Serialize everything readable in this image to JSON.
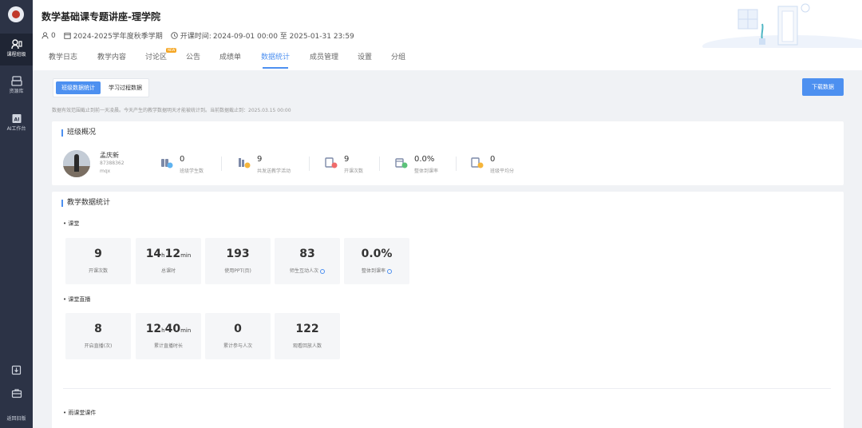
{
  "sidebar": {
    "items": [
      {
        "label": "课程班级",
        "icon": "class-icon",
        "active": true
      },
      {
        "label": "资源库",
        "icon": "library-icon",
        "active": false
      },
      {
        "label": "AI工作台",
        "icon": "ai-icon",
        "active": false
      }
    ],
    "bottom": {
      "label": "返回旧版"
    }
  },
  "header": {
    "title": "数学基础课专题讲座-理学院",
    "people_count": "0",
    "semester": "2024-2025学年度秋季学期",
    "time_label": "开课时间:",
    "time_value": "2024-09-01 00:00 至 2025-01-31 23:59",
    "tabs": [
      {
        "label": "教学日志"
      },
      {
        "label": "教学内容"
      },
      {
        "label": "讨论区",
        "badge": "NEW"
      },
      {
        "label": "公告"
      },
      {
        "label": "成绩单"
      },
      {
        "label": "数据统计",
        "active": true
      },
      {
        "label": "成员管理"
      },
      {
        "label": "设置"
      },
      {
        "label": "分组"
      }
    ]
  },
  "toolbar": {
    "toggle": [
      "班级数据统计",
      "学习过程数据"
    ],
    "download_label": "下载数据",
    "note": "数据有效范围截止到前一天凌晨。今天产生的教学数据明天才能被统计到。当前数据截止到：2025.03.15 00:00"
  },
  "overview": {
    "title": "班级概况",
    "teacher": {
      "name": "孟庆新",
      "id": "87388362",
      "sub": "mqx"
    },
    "stats": [
      {
        "value": "0",
        "label": "班级学生数",
        "icon": "students-icon"
      },
      {
        "value": "9",
        "label": "共发送教学活动",
        "icon": "activities-icon"
      },
      {
        "value": "9",
        "label": "开课次数",
        "icon": "lessons-icon"
      },
      {
        "value": "0.0%",
        "label": "整体到课率",
        "icon": "attendance-icon"
      },
      {
        "value": "0",
        "label": "班级平均分",
        "icon": "average-score-icon"
      }
    ]
  },
  "teaching": {
    "title": "教学数据统计",
    "sections": [
      {
        "label": "课堂",
        "stats": [
          {
            "value": "9",
            "label": "开课次数"
          },
          {
            "value_h": "14",
            "unit_h": "h",
            "value_m": "12",
            "unit_m": "min",
            "label": "总课时"
          },
          {
            "value": "193",
            "label": "使用PPT(页)"
          },
          {
            "value": "83",
            "label": "师生互动人次",
            "info": true
          },
          {
            "value": "0.0%",
            "label": "整体到课率",
            "info": true
          }
        ]
      },
      {
        "label": "课堂直播",
        "stats": [
          {
            "value": "8",
            "label": "开启直播(次)"
          },
          {
            "value_h": "12",
            "unit_h": "h",
            "value_m": "40",
            "unit_m": "min",
            "label": "累计直播时长"
          },
          {
            "value": "0",
            "label": "累计参与人次"
          },
          {
            "value": "122",
            "label": "观看回放人数"
          }
        ]
      },
      {
        "label": "雨课堂课件"
      }
    ]
  },
  "colors": {
    "accent": "#4d90f0",
    "sidebar": "#2c3346",
    "badge": "#f5a623"
  }
}
